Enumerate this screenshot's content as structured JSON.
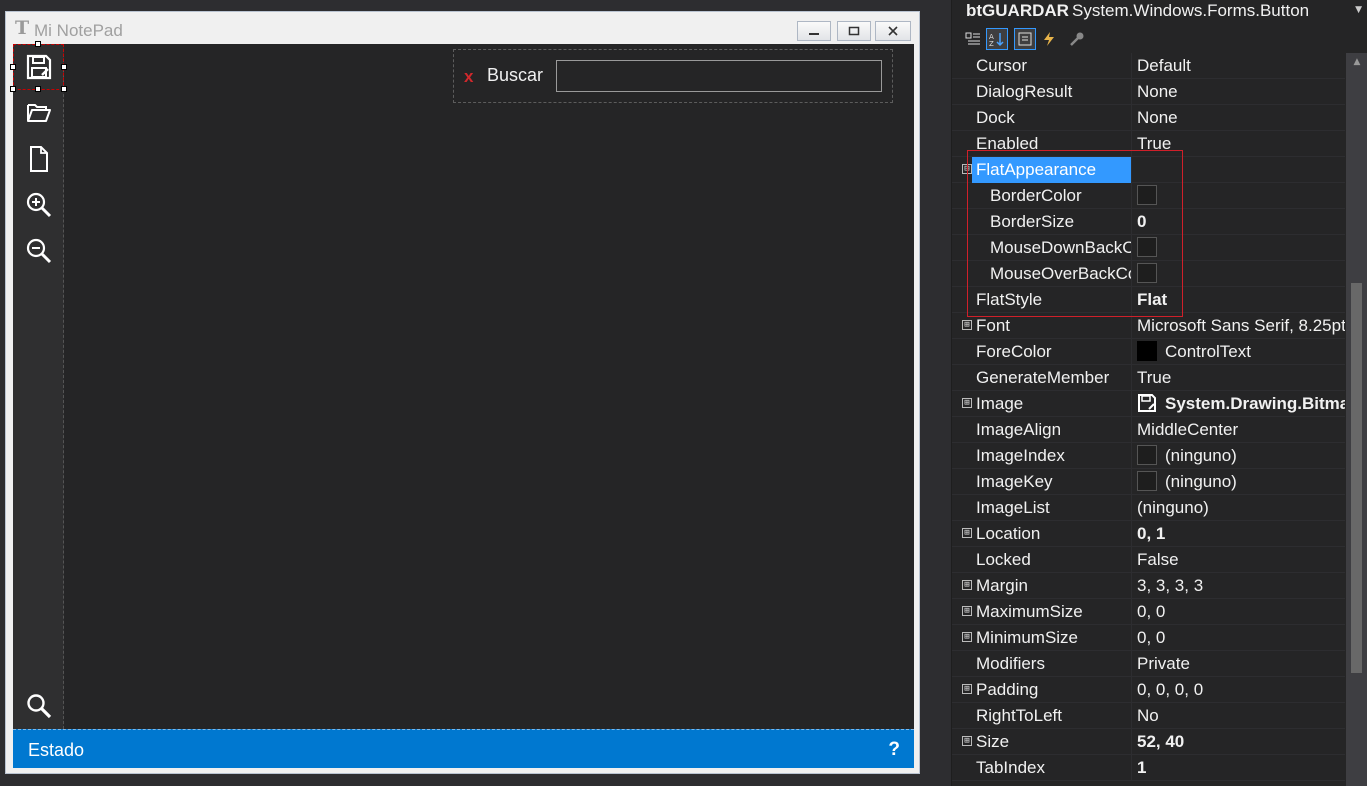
{
  "form": {
    "title": "Mi NotePad",
    "app_icon_glyph": "T",
    "title_buttons": {
      "minimize": "minimize-icon",
      "maximize": "maximize-icon",
      "close": "close-icon"
    }
  },
  "toolbar": {
    "buttons": [
      {
        "name": "save",
        "icon": "floppy-disk-icon"
      },
      {
        "name": "open",
        "icon": "folder-open-icon"
      },
      {
        "name": "new",
        "icon": "new-file-icon"
      },
      {
        "name": "zoom-in",
        "icon": "zoom-in-icon"
      },
      {
        "name": "zoom-out",
        "icon": "zoom-out-icon"
      },
      {
        "name": "search",
        "icon": "search-icon"
      }
    ]
  },
  "search": {
    "close_glyph": "x",
    "label": "Buscar",
    "value": ""
  },
  "status": {
    "text": "Estado",
    "help": "?"
  },
  "properties": {
    "object_name": "btGUARDAR",
    "object_type": "System.Windows.Forms.Button",
    "rows": [
      {
        "name": "Cursor",
        "value": "Default"
      },
      {
        "name": "DialogResult",
        "value": "None"
      },
      {
        "name": "Dock",
        "value": "None"
      },
      {
        "name": "Enabled",
        "value": "True"
      },
      {
        "name": "FlatAppearance",
        "value": "",
        "expander": "⊟",
        "selected": true
      },
      {
        "name": "BorderColor",
        "value": "",
        "child": true,
        "swatch": "empty"
      },
      {
        "name": "BorderSize",
        "value": "0",
        "child": true,
        "bold": true
      },
      {
        "name": "MouseDownBackColor",
        "value": "",
        "child": true,
        "swatch": "empty"
      },
      {
        "name": "MouseOverBackColor",
        "value": "",
        "child": true,
        "swatch": "empty"
      },
      {
        "name": "FlatStyle",
        "value": "Flat",
        "bold": true
      },
      {
        "name": "Font",
        "value": "Microsoft Sans Serif, 8.25pt",
        "expander": "⊞"
      },
      {
        "name": "ForeColor",
        "value": "ControlText",
        "swatch": "black"
      },
      {
        "name": "GenerateMember",
        "value": "True"
      },
      {
        "name": "Image",
        "value": "System.Drawing.Bitmap",
        "expander": "⊞",
        "bold": true,
        "image": true
      },
      {
        "name": "ImageAlign",
        "value": "MiddleCenter"
      },
      {
        "name": "ImageIndex",
        "value": "(ninguno)",
        "swatch": "empty"
      },
      {
        "name": "ImageKey",
        "value": "(ninguno)",
        "swatch": "empty"
      },
      {
        "name": "ImageList",
        "value": "(ninguno)"
      },
      {
        "name": "Location",
        "value": "0, 1",
        "expander": "⊞",
        "bold": true
      },
      {
        "name": "Locked",
        "value": "False"
      },
      {
        "name": "Margin",
        "value": "3, 3, 3, 3",
        "expander": "⊞"
      },
      {
        "name": "MaximumSize",
        "value": "0, 0",
        "expander": "⊞"
      },
      {
        "name": "MinimumSize",
        "value": "0, 0",
        "expander": "⊞"
      },
      {
        "name": "Modifiers",
        "value": "Private"
      },
      {
        "name": "Padding",
        "value": "0, 0, 0, 0",
        "expander": "⊞"
      },
      {
        "name": "RightToLeft",
        "value": "No"
      },
      {
        "name": "Size",
        "value": "52, 40",
        "expander": "⊞",
        "bold": true
      },
      {
        "name": "TabIndex",
        "value": "1",
        "bold": true
      }
    ]
  }
}
